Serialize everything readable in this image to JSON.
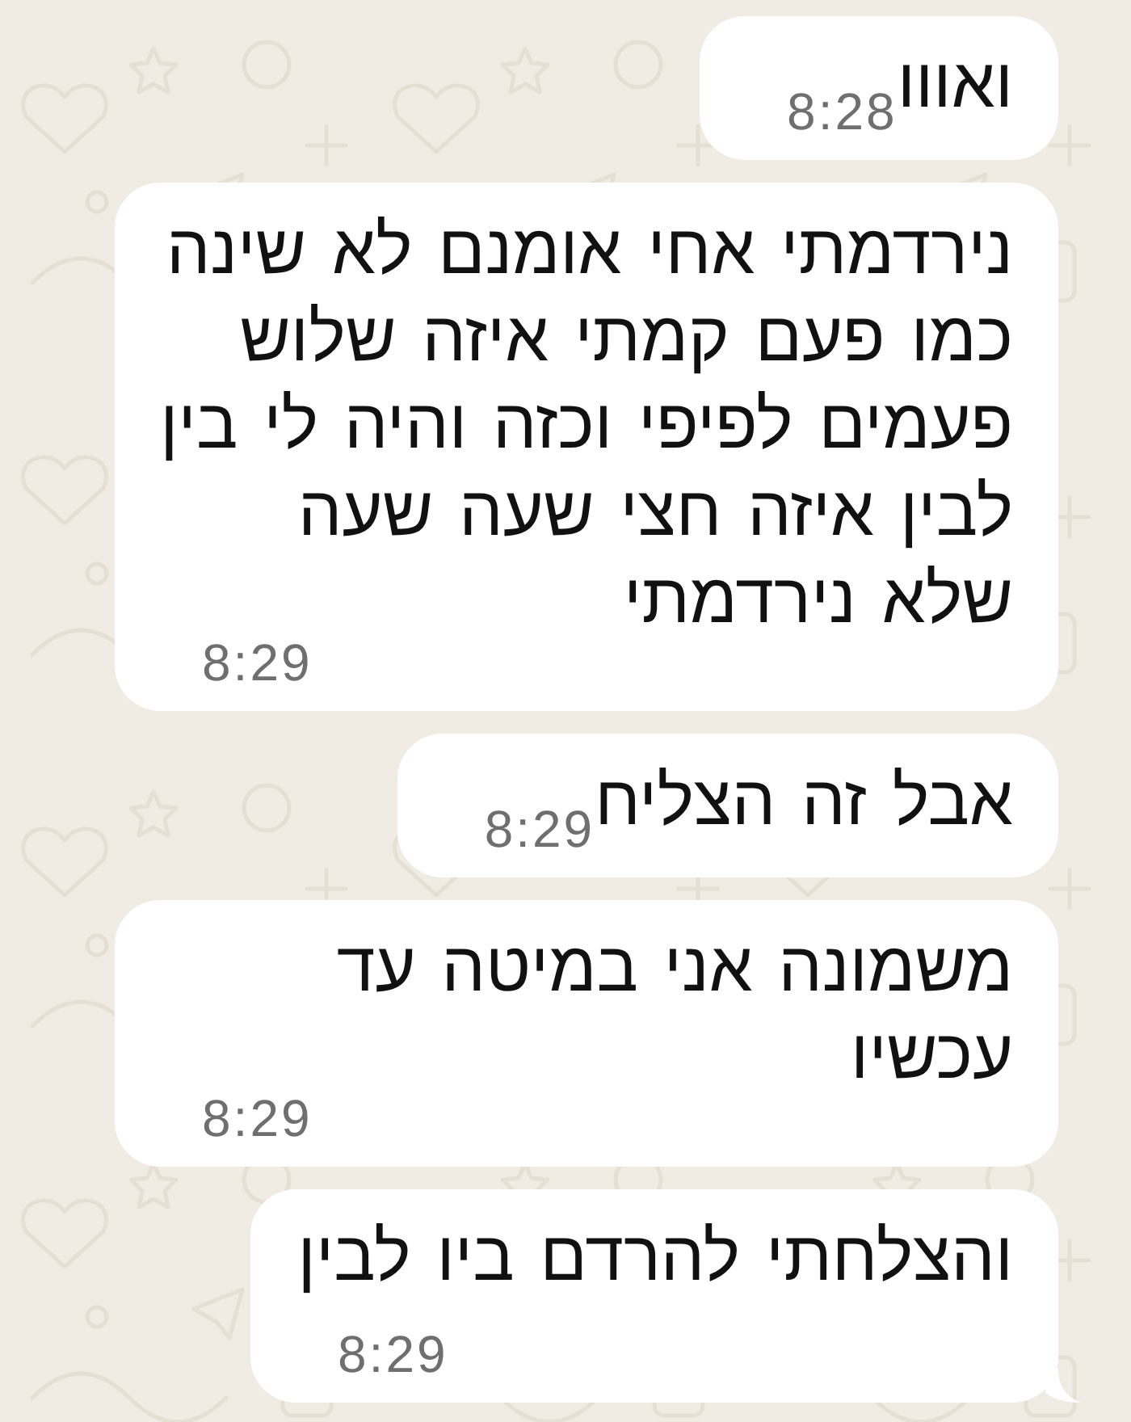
{
  "messages": [
    {
      "text": "ואווו",
      "time": "8:28",
      "tail": false
    },
    {
      "text": "נירדמתי אחי אומנם לא שינה כמו פעם קמתי איזה שלוש פעמים לפיפי וכזה והיה לי בין לבין איזה חצי שעה שעה שלא נירדמתי",
      "time": "8:29",
      "tail": false
    },
    {
      "text": "אבל זה הצליח",
      "time": "8:29",
      "tail": false
    },
    {
      "text": "משמונה אני במיטה עד עכשיו",
      "time": "8:29",
      "tail": false
    },
    {
      "text": "והצלחתי להרדם ביו לבין",
      "time": "8:29",
      "tail": true
    }
  ]
}
